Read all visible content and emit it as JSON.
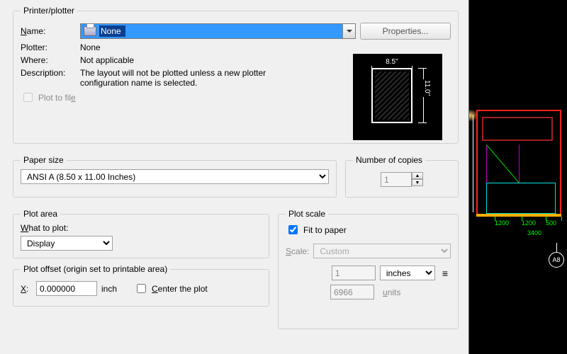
{
  "printer": {
    "legend": "Printer/plotter",
    "name_label": "Name:",
    "name_value": "None",
    "properties_btn": "Properties...",
    "plotter_label": "Plotter:",
    "plotter_value": "None",
    "where_label": "Where:",
    "where_value": "Not applicable",
    "desc_label": "Description:",
    "desc_value": "The layout will not be plotted unless a new plotter configuration name is selected.",
    "plot_to_file": "Plot to file",
    "preview_w": "8.5''",
    "preview_h": "11.0''"
  },
  "paper": {
    "legend": "Paper size",
    "value": "ANSI A (8.50 x 11.00 Inches)"
  },
  "copies": {
    "legend": "Number of copies",
    "value": "1"
  },
  "plotarea": {
    "legend": "Plot area",
    "what_label": "What to plot:",
    "value": "Display"
  },
  "plotscale": {
    "legend": "Plot scale",
    "fit_label": "Fit to paper",
    "scale_label": "Scale:",
    "scale_value": "Custom",
    "num": "1",
    "unit": "inches",
    "den": "6966",
    "den_unit": "units"
  },
  "offset": {
    "legend": "Plot offset (origin set to printable area)",
    "x_label": "X:",
    "x_value": "0.000000",
    "x_unit": "inch",
    "center": "Center the plot"
  },
  "cad": {
    "d1": "1200",
    "d2": "1200",
    "d3": "500",
    "d4": "3400",
    "marker": "A8"
  }
}
